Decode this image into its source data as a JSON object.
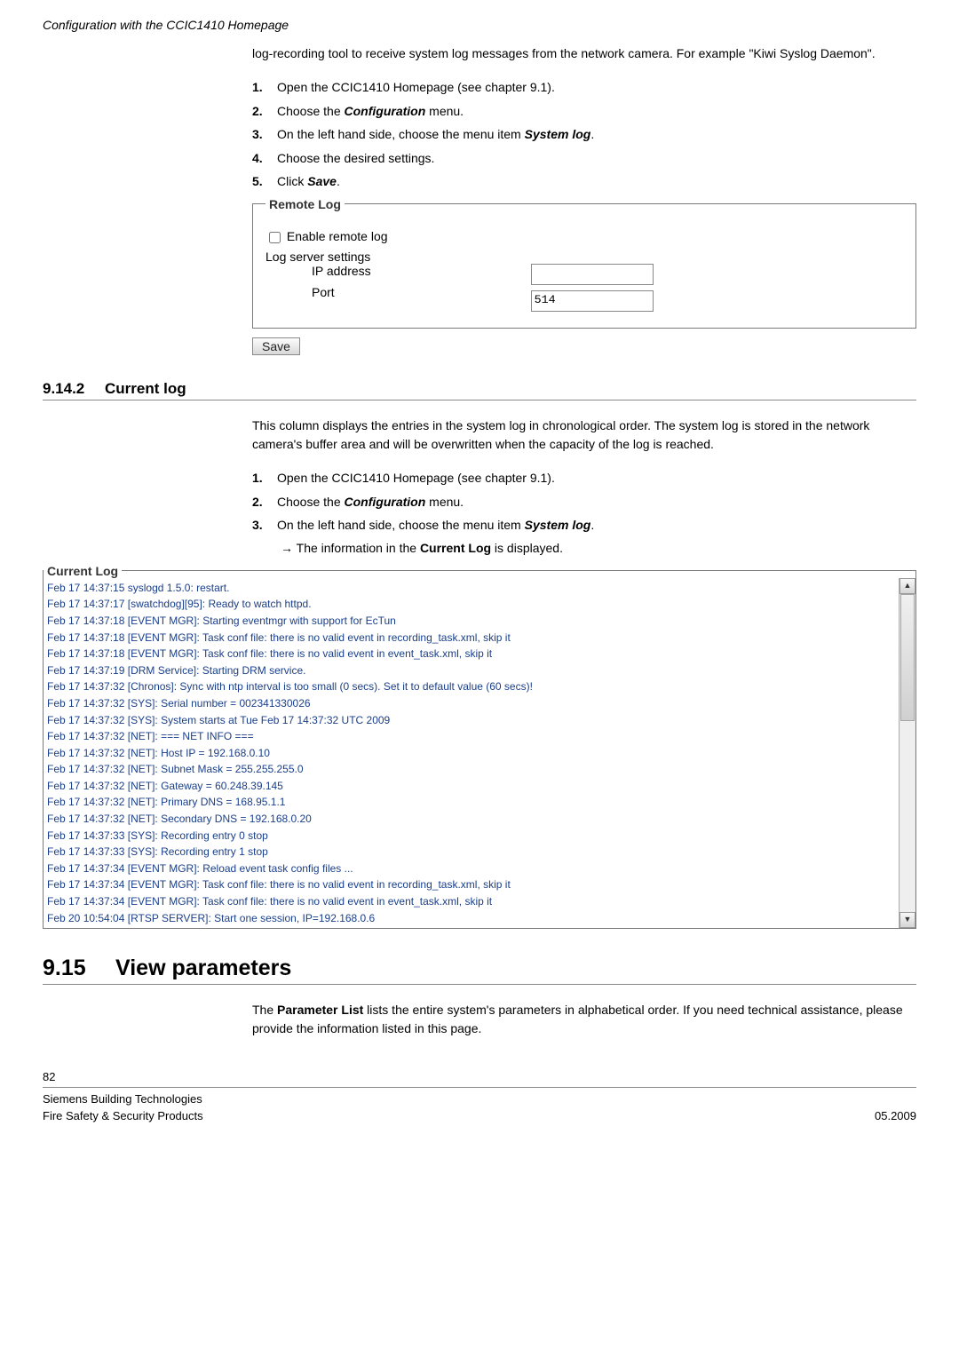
{
  "header": {
    "title": "Configuration with the CCIC1410 Homepage"
  },
  "intro1": "log-recording tool to receive system log messages from the network camera. For example \"Kiwi Syslog Daemon\".",
  "steps1": [
    {
      "num": "1.",
      "text_pre": "Open the CCIC1410 Homepage (see chapter 9.1)."
    },
    {
      "num": "2.",
      "text_pre": "Choose the ",
      "bi": "Configuration",
      "text_post": " menu."
    },
    {
      "num": "3.",
      "text_pre": "On the left hand side, choose the menu item ",
      "bi": "System log",
      "text_post": "."
    },
    {
      "num": "4.",
      "text_pre": "Choose the desired settings."
    },
    {
      "num": "5.",
      "text_pre": "Click ",
      "bi": "Save",
      "text_post": "."
    }
  ],
  "remote_log": {
    "legend": "Remote Log",
    "enable_label": "Enable remote log",
    "server_settings": "Log server settings",
    "ip_label": "IP address",
    "port_label": "Port",
    "ip_value": "",
    "port_value": "514",
    "save_label": "Save"
  },
  "section_9_14_2": {
    "num": "9.14.2",
    "title": "Current log"
  },
  "para_9_14_2": "This column displays the entries in the system log in chronological order. The system log is stored in the network camera's buffer area and will be overwritten when the capacity of the log is reached.",
  "steps2": [
    {
      "num": "1.",
      "text_pre": "Open the CCIC1410 Homepage (see chapter 9.1)."
    },
    {
      "num": "2.",
      "text_pre": "Choose the ",
      "bi": "Configuration",
      "text_post": " menu."
    },
    {
      "num": "3.",
      "text_pre": "On the left hand side, choose the menu item ",
      "bi": "System log",
      "text_post": "."
    }
  ],
  "arrow_line": {
    "arrow": "→",
    "pre": " The information in the ",
    "bold": "Current Log",
    "post": " is displayed."
  },
  "current_log": {
    "legend": "Current Log",
    "lines": [
      "Feb 17 14:37:15 syslogd 1.5.0: restart.",
      "Feb 17 14:37:17 [swatchdog][95]: Ready to watch httpd.",
      "Feb 17 14:37:18 [EVENT MGR]: Starting eventmgr with support for EcTun",
      "Feb 17 14:37:18 [EVENT MGR]: Task conf file: there is no valid event in recording_task.xml, skip it",
      "Feb 17 14:37:18 [EVENT MGR]: Task conf file: there is no valid event in event_task.xml, skip it",
      "Feb 17 14:37:19 [DRM Service]: Starting DRM service.",
      "Feb 17 14:37:32 [Chronos]: Sync with ntp interval is too small (0 secs). Set it to default value (60 secs)!",
      "Feb 17 14:37:32 [SYS]: Serial number = 002341330026",
      "Feb 17 14:37:32 [SYS]: System starts at Tue Feb 17 14:37:32 UTC 2009",
      "Feb 17 14:37:32 [NET]: === NET INFO ===",
      "Feb 17 14:37:32 [NET]: Host IP = 192.168.0.10",
      "Feb 17 14:37:32 [NET]: Subnet Mask = 255.255.255.0",
      "Feb 17 14:37:32 [NET]: Gateway = 60.248.39.145",
      "Feb 17 14:37:32 [NET]: Primary DNS = 168.95.1.1",
      "Feb 17 14:37:32 [NET]: Secondary DNS = 192.168.0.20",
      "Feb 17 14:37:33 [SYS]: Recording entry 0 stop",
      "Feb 17 14:37:33 [SYS]: Recording entry 1 stop",
      "Feb 17 14:37:34 [EVENT MGR]: Reload event task config files ...",
      "Feb 17 14:37:34 [EVENT MGR]: Task conf file: there is no valid event in recording_task.xml, skip it",
      "Feb 17 14:37:34 [EVENT MGR]: Task conf file: there is no valid event in event_task.xml, skip it",
      "Feb 20 10:54:04 [RTSP SERVER]: Start one session, IP=192.168.0.6"
    ]
  },
  "section_9_15": {
    "num": "9.15",
    "title": "View parameters"
  },
  "para_9_15_pre": "The ",
  "para_9_15_bold": "Parameter List",
  "para_9_15_post": " lists the entire system's parameters in alphabetical order. If you need technical assistance, please provide the information listed in this page.",
  "footer": {
    "page": "82",
    "left1": "Siemens Building Technologies",
    "left2": "Fire Safety & Security Products",
    "right": "05.2009"
  }
}
